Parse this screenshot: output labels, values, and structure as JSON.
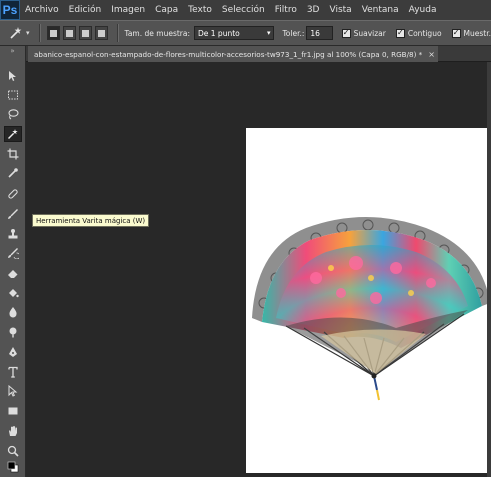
{
  "app": {
    "logo": "Ps"
  },
  "menu": [
    "Archivo",
    "Edición",
    "Imagen",
    "Capa",
    "Texto",
    "Selección",
    "Filtro",
    "3D",
    "Vista",
    "Ventana",
    "Ayuda"
  ],
  "options": {
    "sample_label": "Tam. de muestra:",
    "sample_value": "De 1 punto",
    "tolerance_label": "Toler.:",
    "tolerance_value": "16",
    "antialias_label": "Suavizar",
    "contiguous_label": "Contiguo",
    "sample_all_label": "Muestr. "
  },
  "document": {
    "tab_title": "abanico-espanol-con-estampado-de-flores-multicolor-accesorios-tw973_1_fr1.jpg al 100% (Capa 0, RGB/8) *",
    "close_glyph": "×"
  },
  "tooltip": "Herramienta Varita mágica (W)",
  "toolbar": {
    "grip": "»",
    "tools": [
      "move-tool",
      "marquee-tool",
      "lasso-tool",
      "magic-wand-tool",
      "crop-tool",
      "eyedropper-tool",
      "healing-brush-tool",
      "brush-tool",
      "clone-stamp-tool",
      "history-brush-tool",
      "eraser-tool",
      "paint-bucket-tool",
      "blur-tool",
      "dodge-tool",
      "pen-tool",
      "type-tool",
      "path-selection-tool",
      "rectangle-tool",
      "hand-tool",
      "zoom-tool",
      "color-swatches"
    ]
  },
  "colors": {
    "menu_bg": "#3c3c3c",
    "panel_bg": "#535353",
    "workspace_bg": "#282828",
    "ps_blue": "#4da3ff",
    "tooltip_bg": "#fbfbcf"
  }
}
